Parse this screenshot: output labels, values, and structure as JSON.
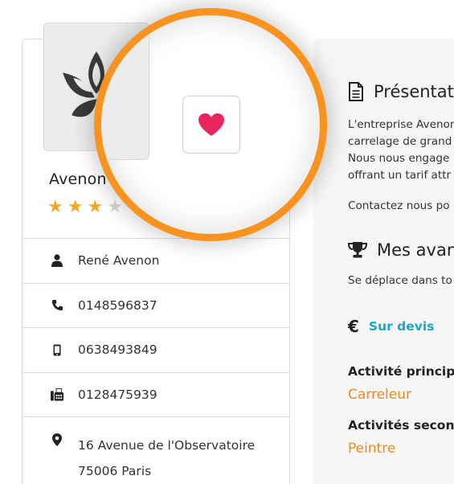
{
  "company": {
    "name": "Avenon",
    "rating": 3,
    "rating_max": 5,
    "rating_paren": ")"
  },
  "contact": {
    "person": "René Avenon",
    "phone": "0148596837",
    "mobile": "0638493849",
    "fax": "0128475939",
    "address_line1": "16 Avenue de l'Observatoire",
    "address_line2": "75006 Paris"
  },
  "presentation": {
    "title": "Présentat",
    "lines": [
      "L'entreprise Avenon",
      "carrelage de grand",
      "Nous nous engage",
      "offrant un tarif attr"
    ],
    "contact_line": "Contactez nous po"
  },
  "advantages": {
    "title": "Mes avan",
    "text": "Se déplace dans to"
  },
  "pricing": {
    "symbol": "€",
    "label": "Sur devis"
  },
  "activities": {
    "main_title": "Activité principa",
    "main_value": "Carreleur",
    "secondary_title": "Activités second",
    "secondary_value": "Peintre"
  },
  "icons": {
    "favorite": "heart-icon",
    "person": "person-icon",
    "phone": "phone-icon",
    "mobile": "mobile-icon",
    "fax": "fax-icon",
    "address": "map-marker-icon",
    "presentation": "document-icon",
    "advantages": "trophy-icon",
    "logo": "lotus-logo-icon"
  },
  "colors": {
    "accent_orange": "#f7931e",
    "activity_orange": "#f08a1c",
    "price_blue": "#1aa7c2",
    "heart_pink": "#e8255f",
    "star_gold": "#f5a623"
  }
}
